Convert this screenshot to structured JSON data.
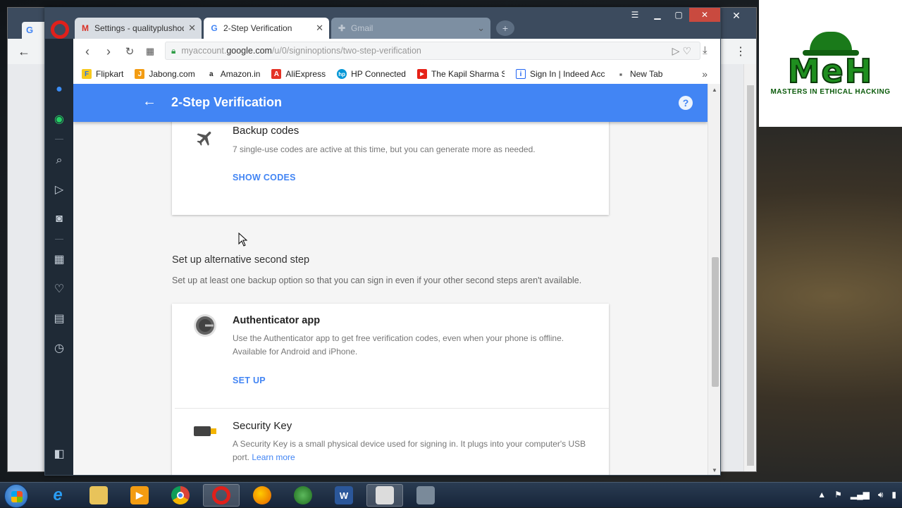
{
  "browser": {
    "tabs": [
      {
        "title": "Settings - qualityplushoda",
        "favicon": "gmail-icon"
      },
      {
        "title": "2-Step Verification",
        "favicon": "google-icon"
      },
      {
        "title": "Gmail",
        "favicon": "gmail-icon"
      }
    ],
    "url": {
      "prefix": "myaccount.",
      "host": "google.com",
      "path": "/u/0/signinoptions/two-step-verification"
    },
    "bookmarks": [
      {
        "label": "Flipkart",
        "color": "#f7c91d",
        "glyph": "F"
      },
      {
        "label": "Jabong.com",
        "color": "#f39c12",
        "glyph": "J"
      },
      {
        "label": "Amazon.in",
        "color": "#222222",
        "glyph": "a"
      },
      {
        "label": "AliExpress",
        "color": "#e43225",
        "glyph": "A"
      },
      {
        "label": "HP Connected",
        "color": "#0096d6",
        "glyph": "hp"
      },
      {
        "label": "The Kapil Sharma Sho",
        "color": "#e62117",
        "glyph": "▶"
      },
      {
        "label": "Sign In | Indeed Acco",
        "color": "#2164f3",
        "glyph": "i"
      },
      {
        "label": "New Tab",
        "color": "#777777",
        "glyph": "▪"
      }
    ]
  },
  "page": {
    "header_title": "2-Step Verification",
    "backup_codes": {
      "title": "Backup codes",
      "description": "7 single-use codes are active at this time, but you can generate more as needed.",
      "action": "SHOW CODES"
    },
    "alt_section": {
      "heading": "Set up alternative second step",
      "description": "Set up at least one backup option so that you can sign in even if your other second steps aren't available."
    },
    "authenticator": {
      "title": "Authenticator app",
      "description_line1": "Use the Authenticator app to get free verification codes, even when your phone is offline.",
      "description_line2": "Available for Android and iPhone.",
      "action": "SET UP"
    },
    "security_key": {
      "title": "Security Key",
      "description_line1": "A Security Key is a small physical device used for signing in. It plugs into your computer's USB",
      "description_line2": "port.",
      "link": "Learn more"
    }
  },
  "logo": {
    "mark": "MeH",
    "tagline": "MASTERS IN ETHICAL HACKING"
  },
  "colors": {
    "accent": "#4285f4",
    "opera_red": "#e0201b"
  }
}
